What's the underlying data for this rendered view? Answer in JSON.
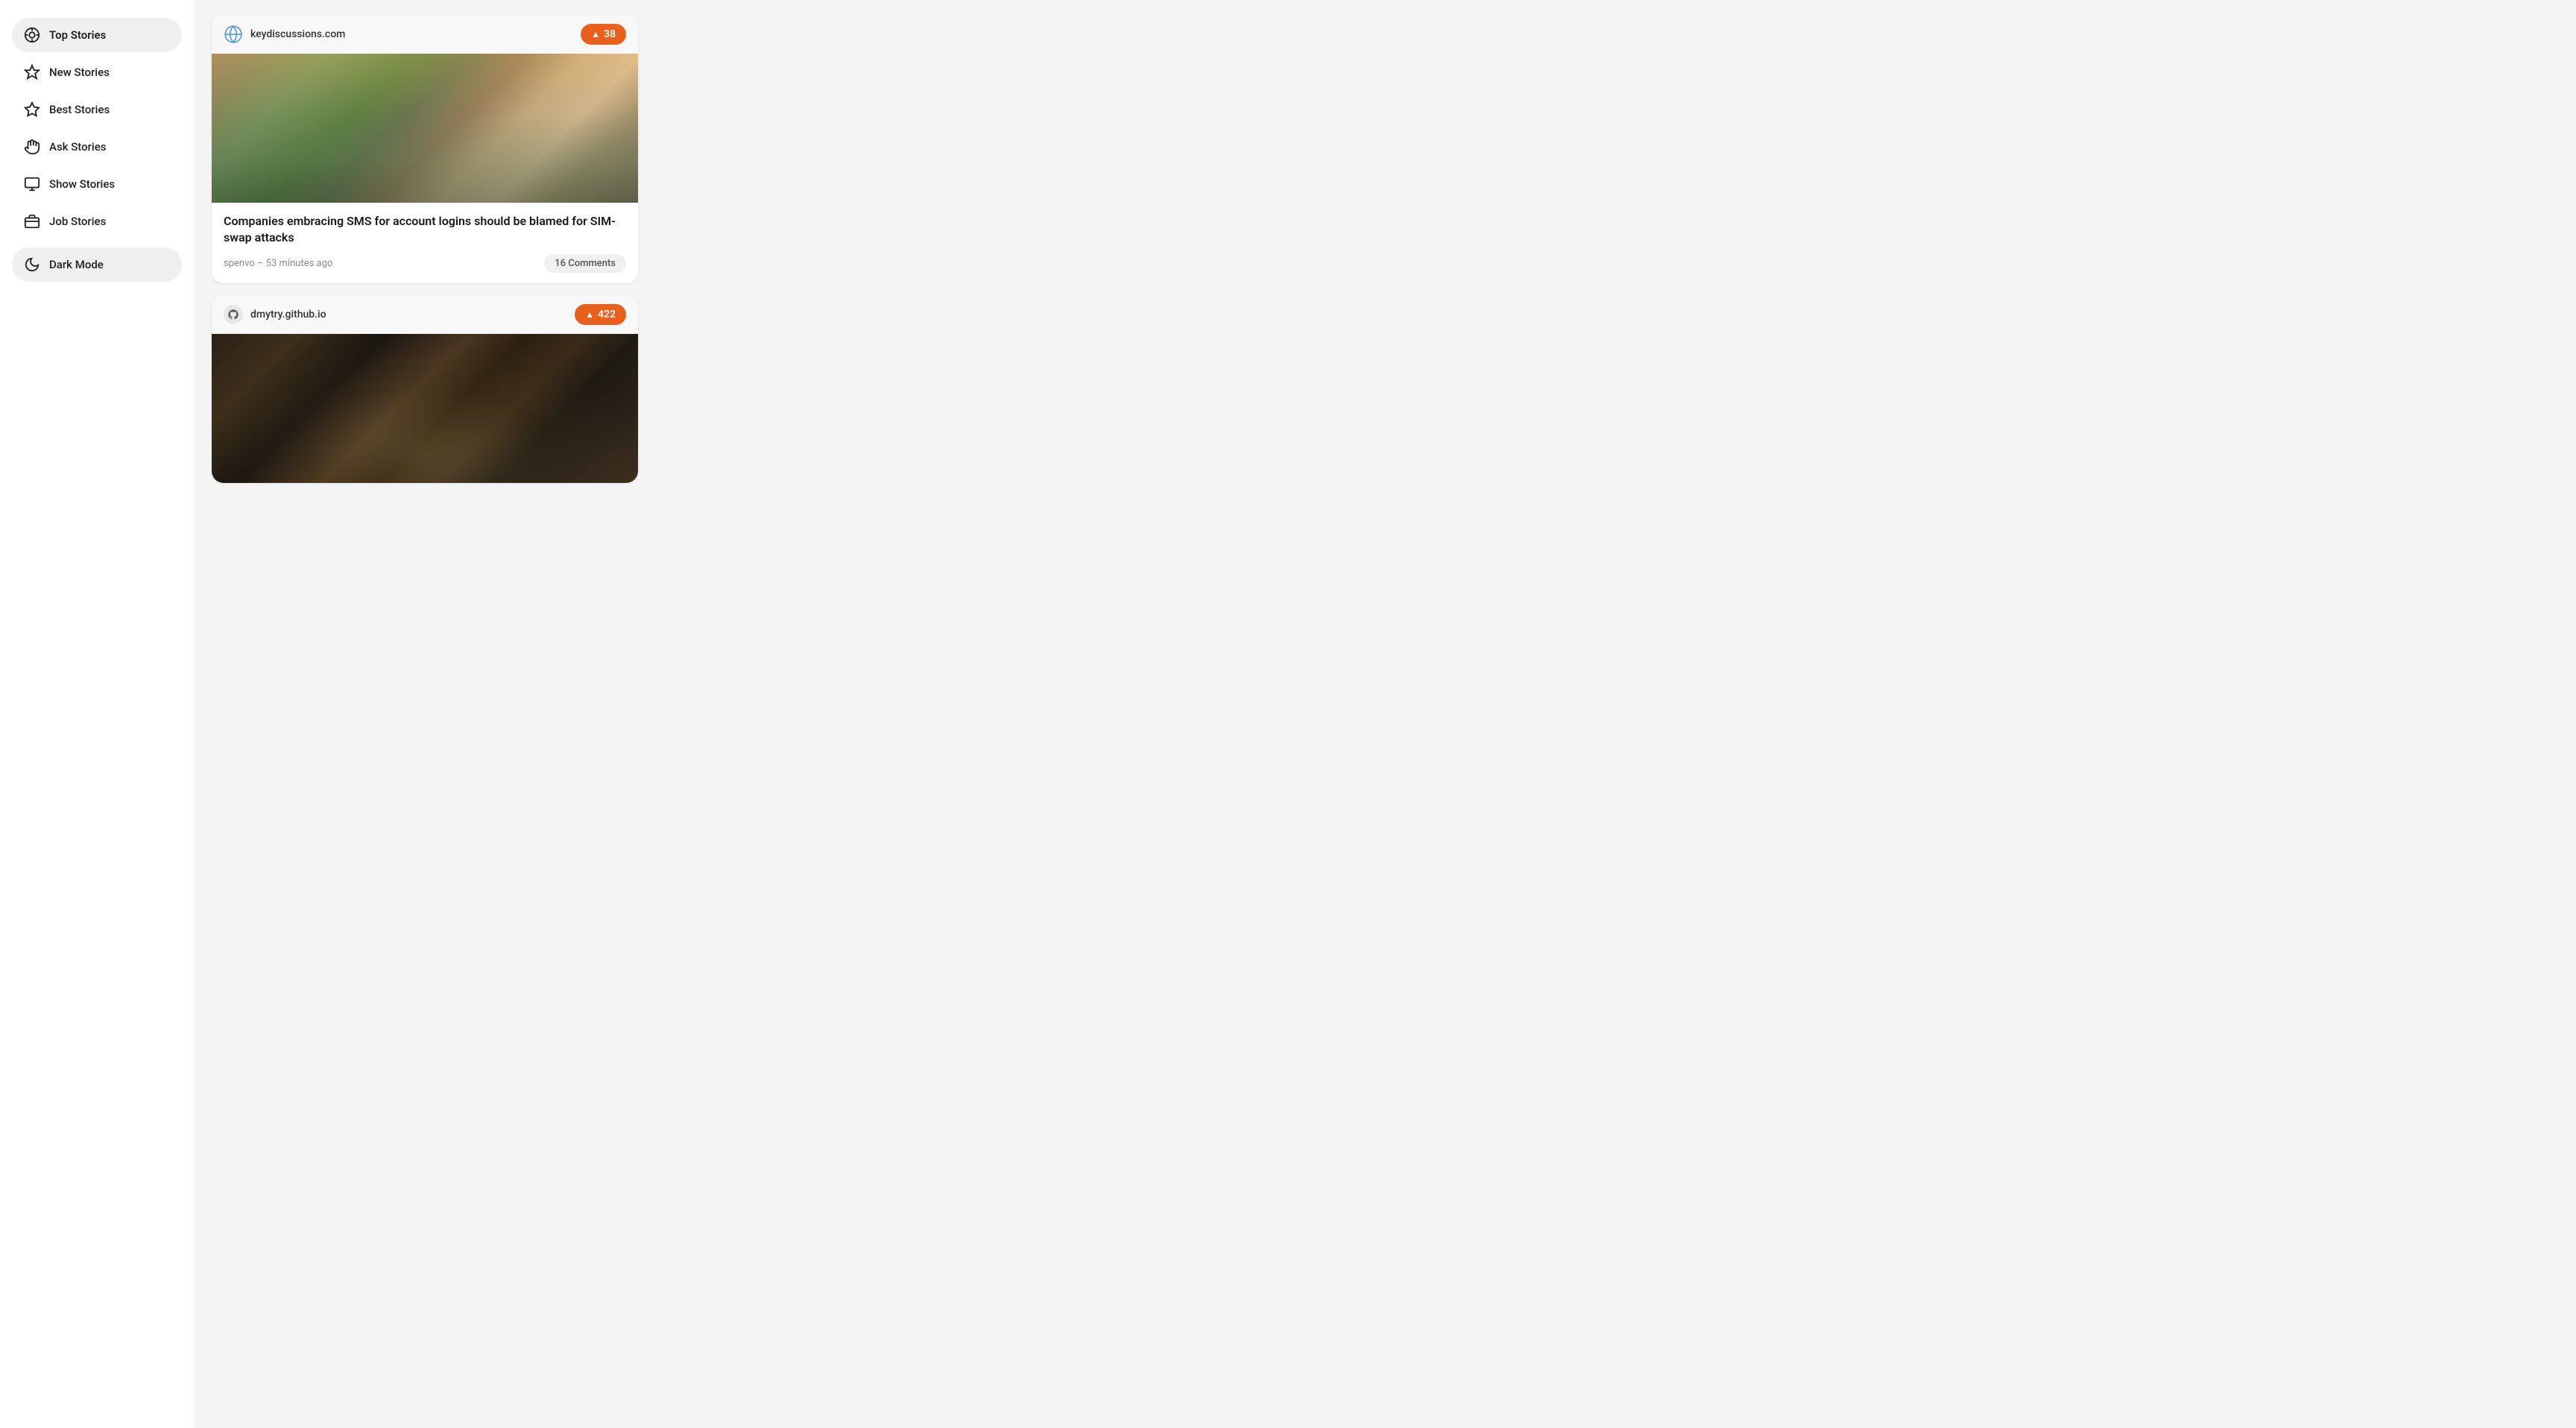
{
  "sidebar": {
    "items": [
      {
        "id": "top-stories",
        "label": "Top Stories",
        "icon": "target",
        "active": true
      },
      {
        "id": "new-stories",
        "label": "New Stories",
        "icon": "sparkle",
        "active": false
      },
      {
        "id": "best-stories",
        "label": "Best Stories",
        "icon": "star",
        "active": false
      },
      {
        "id": "ask-stories",
        "label": "Ask Stories",
        "icon": "hand",
        "active": false
      },
      {
        "id": "show-stories",
        "label": "Show Stories",
        "icon": "monitor",
        "active": false
      },
      {
        "id": "job-stories",
        "label": "Job Stories",
        "icon": "briefcase",
        "active": false
      }
    ],
    "dark_mode_label": "Dark Mode",
    "dark_mode_icon": "moon"
  },
  "stories": [
    {
      "id": 1,
      "source": "keydiscussions.com",
      "source_type": "globe",
      "votes": 38,
      "title": "Companies embracing SMS for account logins should be blamed for SIM-swap attacks",
      "author": "spenvo",
      "time_ago": "53 minutes ago",
      "comments_count": "16 Comments",
      "has_image": true,
      "image_type": "phone-user"
    },
    {
      "id": 2,
      "source": "dmytry.github.io",
      "source_type": "github",
      "votes": 422,
      "title": "",
      "author": "",
      "time_ago": "",
      "comments_count": "",
      "has_image": true,
      "image_type": "dark-blur"
    }
  ],
  "colors": {
    "accent": "#e8601c",
    "active_bg": "#efefef",
    "card_bg": "#ffffff",
    "sidebar_bg": "#ffffff"
  }
}
